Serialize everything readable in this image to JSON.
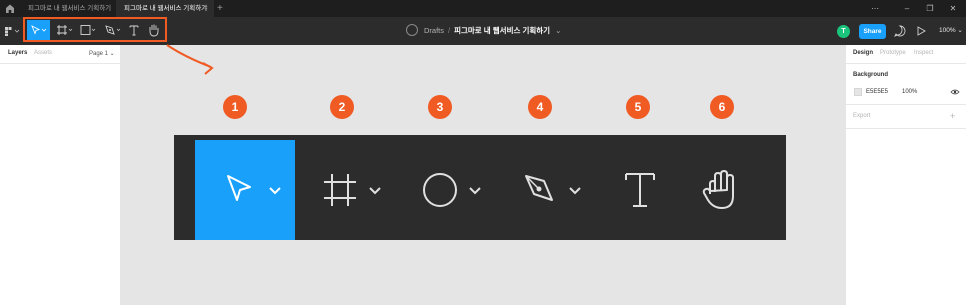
{
  "titlebar": {
    "tabs": [
      {
        "label": "피그마로 내 웹서비스 기획하기"
      },
      {
        "label": "피그마로 내 웹서비스 기획하기",
        "close": "×"
      }
    ],
    "add_tab": "+",
    "window_controls": [
      "⋯",
      "–",
      "❐",
      "✕"
    ]
  },
  "toolbar": {
    "breadcrumb": {
      "folder": "Drafts",
      "separator": "/",
      "file": "피그마로 내 웹서비스 기획하기",
      "chevron": "⌄"
    },
    "avatar_initial": "T",
    "share_label": "Share",
    "zoom_label": "100% ⌄",
    "tools": [
      "move-tool",
      "frame-tool",
      "shape-tool",
      "pen-tool",
      "text-tool",
      "hand-tool"
    ]
  },
  "left_panel": {
    "tabs": [
      "Layers",
      "Assets"
    ],
    "page_selector": "Page 1 ⌄"
  },
  "right_panel": {
    "tabs": [
      "Design",
      "Prototype",
      "Inspect"
    ],
    "background_heading": "Background",
    "background_hex": "E5E5E5",
    "background_opacity": "100%",
    "export_heading": "Export",
    "export_add": "+"
  },
  "canvas": {
    "step_numbers": [
      "1",
      "2",
      "3",
      "4",
      "5",
      "6"
    ]
  },
  "colors": {
    "accent_blue": "#18a0fb",
    "highlight_orange": "#f05a23",
    "toolbar_bg": "#2c2c2c",
    "canvas_bg": "#e5e5e5"
  }
}
